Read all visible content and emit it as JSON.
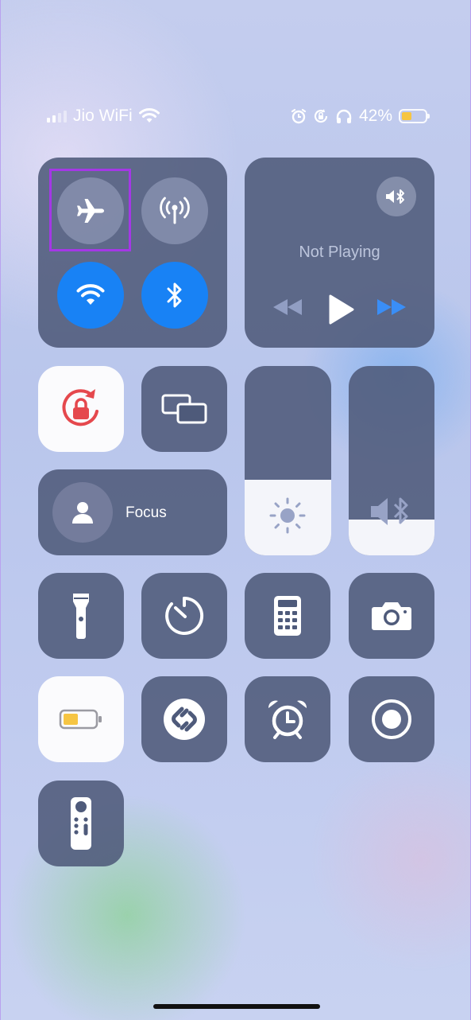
{
  "status_bar": {
    "carrier": "Jio WiFi",
    "battery_percent": "42%",
    "battery_level": 0.42,
    "icons": [
      "signal-icon",
      "wifi-icon",
      "alarm-icon",
      "rotation-lock-icon",
      "headphones-icon",
      "battery-icon"
    ]
  },
  "connectivity": {
    "airplane": {
      "icon": "airplane-icon",
      "on": false
    },
    "cellular": {
      "icon": "cellular-data-icon",
      "on": false
    },
    "wifi": {
      "icon": "wifi-icon",
      "on": true
    },
    "bluetooth": {
      "icon": "bluetooth-icon",
      "on": true
    }
  },
  "now_playing": {
    "status": "Not Playing",
    "output_icon": "audio-output-icon"
  },
  "focus": {
    "label": "Focus",
    "icon": "person-icon"
  },
  "sliders": {
    "brightness_level": 0.4,
    "volume_level": 0.19
  },
  "controls": [
    "rotation-lock-icon",
    "screen-mirroring-icon",
    "flashlight-icon",
    "timer-icon",
    "calculator-icon",
    "camera-icon",
    "low-power-mode-icon",
    "shazam-icon",
    "alarm-icon",
    "screen-recording-icon",
    "apple-tv-remote-icon"
  ],
  "colors": {
    "accent_blue": "#1882f5",
    "highlight": "#a438e6",
    "battery_yellow": "#f6c543",
    "lock_red": "#e5484d"
  }
}
